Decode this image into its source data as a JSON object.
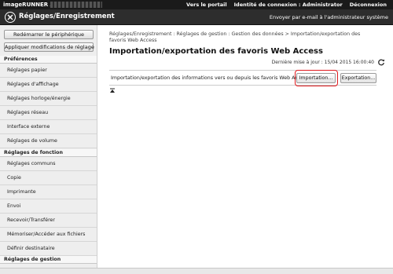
{
  "topbar": {
    "brand": "imageRUNNER ADVANCE",
    "links": [
      "Vers le portail",
      "Identité de connexion : Administrator",
      "Déconnexion"
    ]
  },
  "header": {
    "title": "Réglages/Enregistrement",
    "email_link": "Envoyer par e-mail à l'administrateur système"
  },
  "sidebar": {
    "restart_button": "Redémarrer le périphérique",
    "apply_button": "Appliquer modifications de réglage",
    "sections": [
      {
        "label": "Préférences",
        "items": [
          "Réglages papier",
          "Réglages d'affichage",
          "Réglages horloge/énergie",
          "Réglages réseau",
          "Interface externe",
          "Réglages de volume"
        ]
      },
      {
        "label": "Réglages de fonction",
        "items": [
          "Réglages communs",
          "Copie",
          "Imprimante",
          "Envoi",
          "Recevoir/Transférer",
          "Mémoriser/Accéder aux fichiers",
          "Définir destinataire"
        ]
      },
      {
        "label": "Réglages de gestion",
        "items": []
      }
    ]
  },
  "main": {
    "breadcrumb": "Réglages/Enregistrement : Réglages de gestion : Gestion des données > Importation/exportation des favoris Web Access",
    "title": "Importation/exportation des favoris Web Access",
    "last_updated": "Dernière mise à jour : 15/04 2015 16:00:40",
    "row_label": "Importation/exportation des informations vers ou depuis les favoris Web Access",
    "import_button": "Importation...",
    "export_button": "Exportation..."
  },
  "colors": {
    "topbar": "#1a1a1a",
    "header": "#2d2d2d",
    "sidebar": "#eeeeee",
    "highlight": "#e0191d"
  }
}
